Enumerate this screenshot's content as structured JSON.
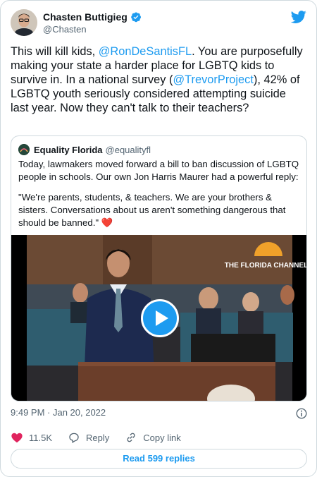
{
  "author": {
    "name": "Chasten Buttigieg",
    "handle": "@Chasten",
    "verified": true
  },
  "tweet": {
    "text_1": "This will kill kids, ",
    "mention_1": "@RonDeSantisFL",
    "text_2": ". You are purposefully making your state a harder place for LGBTQ kids to survive in. In a national survey (",
    "mention_2": "@TrevorProject",
    "text_3": "), 42% of LGBTQ youth seriously considered attempting suicide last year. Now they can't talk to their teachers?"
  },
  "quote": {
    "name": "Equality Florida",
    "handle": "@equalityfl",
    "paragraph_1": "Today, lawmakers moved forward a bill to ban discussion of LGBTQ people in schools. Our own Jon Harris Maurer had a powerful reply:",
    "paragraph_2": "\"We're parents, students, & teachers. We are your brothers & sisters. Conversations about us aren't something dangerous that should be banned.\" ",
    "heart": "❤️",
    "video_watermark": "THE FLORIDA CHANNEL"
  },
  "meta": {
    "timestamp": "9:49 PM · Jan 20, 2022"
  },
  "actions": {
    "likes": "11.5K",
    "reply_label": "Reply",
    "copy_label": "Copy link"
  },
  "replies_button": "Read 599 replies",
  "colors": {
    "accent": "#1d9bf0",
    "text": "#0f1419",
    "secondary": "#536471",
    "like": "#e0245e"
  }
}
